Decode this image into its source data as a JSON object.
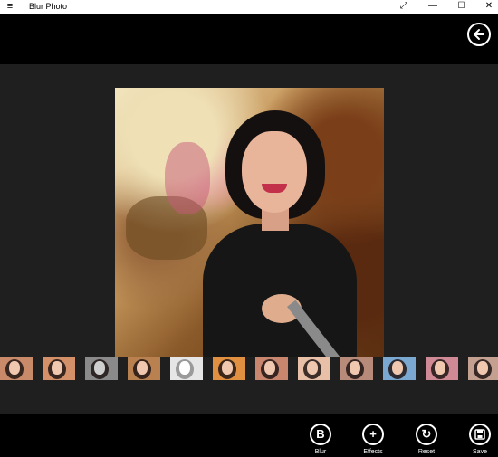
{
  "window": {
    "title": "Blur Photo",
    "menu_icon": "hamburger-icon",
    "controls": [
      "expand-icon",
      "minimize-icon",
      "maximize-icon",
      "close-icon"
    ]
  },
  "topbar": {
    "back_icon": "back-arrow-icon"
  },
  "filters": {
    "count": 12,
    "items": [
      {
        "name": "original",
        "tone": "#c98a6a"
      },
      {
        "name": "warm",
        "tone": "#d49068"
      },
      {
        "name": "grayscale",
        "tone": "#8a8a8a"
      },
      {
        "name": "sepia",
        "tone": "#b9814f"
      },
      {
        "name": "sketch",
        "tone": "#e6e6e6"
      },
      {
        "name": "orange",
        "tone": "#e09040"
      },
      {
        "name": "vivid",
        "tone": "#c8866e"
      },
      {
        "name": "bright",
        "tone": "#e8c0a8"
      },
      {
        "name": "soft",
        "tone": "#b88a7a"
      },
      {
        "name": "cool",
        "tone": "#7aa8d0"
      },
      {
        "name": "pink",
        "tone": "#cf8a96"
      },
      {
        "name": "faded",
        "tone": "#c4a090"
      }
    ]
  },
  "appbar": {
    "buttons": [
      {
        "id": "blur",
        "label": "Blur",
        "glyph": "B",
        "icon": "blur-icon"
      },
      {
        "id": "effects",
        "label": "Effects",
        "glyph": "+",
        "icon": "plus-icon"
      },
      {
        "id": "reset",
        "label": "Reset",
        "glyph": "↻",
        "icon": "reset-icon"
      },
      {
        "id": "save",
        "label": "Save",
        "glyph": "💾",
        "icon": "save-icon"
      }
    ]
  }
}
